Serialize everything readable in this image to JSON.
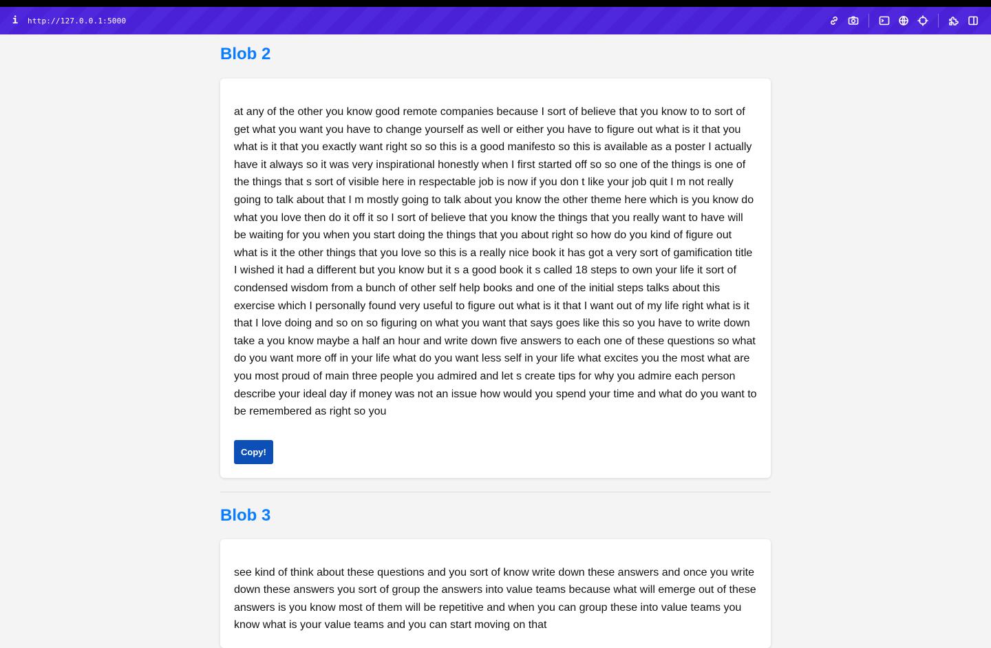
{
  "devbar": {
    "info_label": "i",
    "url": "http://127.0.0.1:5000",
    "tools": [
      "link-icon",
      "camera-icon",
      "terminal-icon",
      "globe-icon",
      "crosshair-icon",
      "extensions-icon",
      "split-view-icon"
    ]
  },
  "blobs": [
    {
      "title": "Blob 2",
      "text": "at any of the other you know good remote companies because I sort of believe that you know to to sort of get what you want you have to change yourself as well or either you have to figure out what is it that you what is it that you exactly want right so so this is a good manifesto so this is available as a poster I actually have it always so it was very inspirational honestly when I first started off so so one of the things is one of the things that s sort of visible here in respectable job is now if you don t like your job quit I m not really going to talk about that I m mostly going to talk about you know the other theme here which is you know do what you love then do it off it so I sort of believe that you know the things that you really want to have will be waiting for you when you start doing the things that you about right so how do you kind of figure out what is it the other things that you love so this is a really nice book it has got a very sort of gamification title I wished it had a different but you know but it s a good book it s called 18 steps to own your life it sort of condensed wisdom from a bunch of other self help books and one of the initial steps talks about this exercise which I personally found very useful to figure out what is it that I want out of my life right what is it that I love doing and so on so figuring on what you want that says goes like this so you have to write down take a you know maybe a half an hour and write down five answers to each one of these questions so what do you want more off in your life what do you want less self in your life what excites you the most what are you most proud of main three people you admired and let s create tips for why you admire each person describe your ideal day if money was not an issue how would you spend your time and what do you want to be remembered as right so you",
      "button": "Copy!"
    },
    {
      "title": "Blob 3",
      "text": "see kind of think about these questions and you sort of know write down these answers and once you write down these answers you sort of group the answers into value teams because what will emerge out of these answers is you know most of them will be repetitive and when you can group these into value teams you know what is your value teams and you can start moving on that"
    }
  ]
}
